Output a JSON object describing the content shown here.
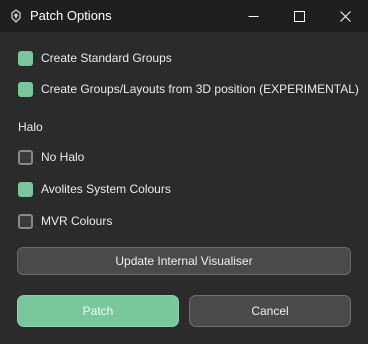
{
  "window": {
    "title": "Patch Options",
    "icon": "app-logo-icon",
    "controls": {
      "minimize_icon": "minimize-icon",
      "maximize_icon": "maximize-icon",
      "close_icon": "close-icon"
    }
  },
  "options": [
    {
      "label": "Create Standard Groups",
      "checked": true
    },
    {
      "label": "Create Groups/Layouts from 3D position (EXPERIMENTAL)",
      "checked": true
    }
  ],
  "halo": {
    "section_label": "Halo",
    "items": [
      {
        "label": "No Halo",
        "checked": false
      },
      {
        "label": "Avolites System Colours",
        "checked": true
      },
      {
        "label": "MVR Colours",
        "checked": false
      }
    ]
  },
  "buttons": {
    "update_visualiser": "Update Internal Visualiser",
    "patch": "Patch",
    "cancel": "Cancel"
  },
  "colors": {
    "accent": "#79c79c",
    "background": "#2b2b2b",
    "titlebar": "#1f1f1f",
    "button": "#4a4a4a"
  }
}
